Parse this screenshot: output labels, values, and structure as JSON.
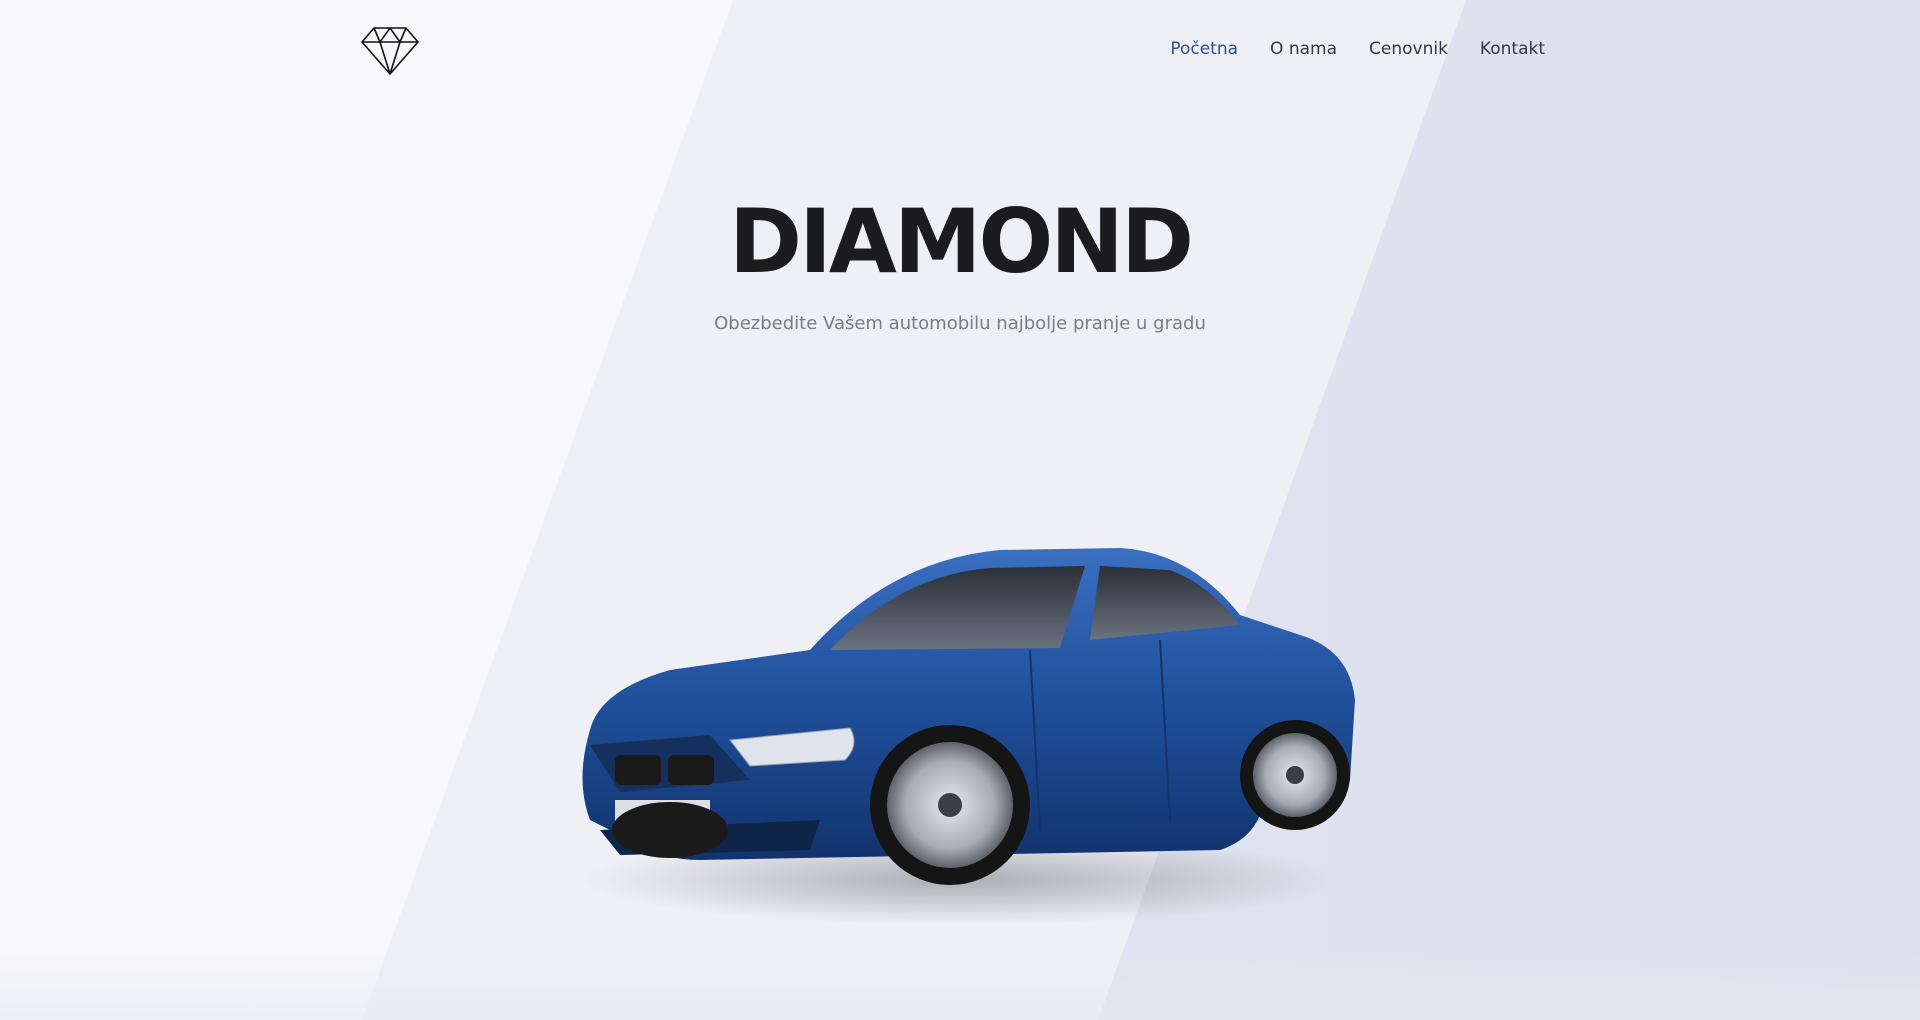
{
  "header": {
    "logo": {
      "icon": "diamond-icon"
    },
    "nav": [
      {
        "label": "Početna",
        "active": true
      },
      {
        "label": "O nama",
        "active": false
      },
      {
        "label": "Cenovnik",
        "active": false
      },
      {
        "label": "Kontakt",
        "active": false
      }
    ]
  },
  "hero": {
    "title": "DIAMOND",
    "subtitle": "Obezbedite Vašem automobilu najbolje pranje u gradu",
    "image": {
      "subject": "blue sedan car",
      "license_plate": ""
    }
  },
  "colors": {
    "nav_active": "#2f4f8f",
    "nav_default": "#333842",
    "title": "#1c1c1e",
    "subtitle": "#7a7c82",
    "car_body": "#1f4f9a"
  }
}
